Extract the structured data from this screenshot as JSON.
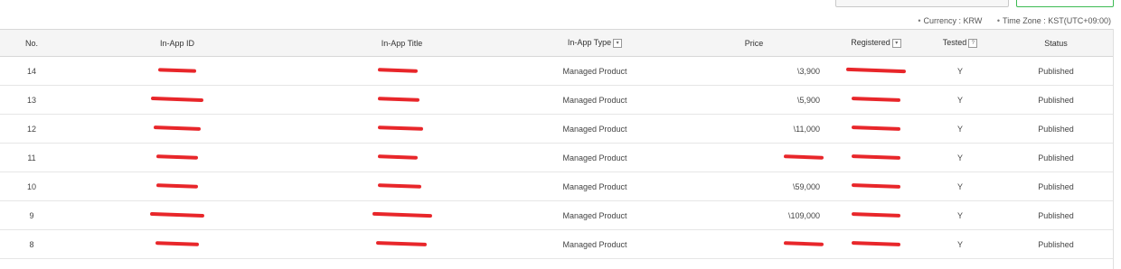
{
  "meta": {
    "currency": "Currency : KRW",
    "timezone": "Time Zone : KST(UTC+09:00)"
  },
  "columns": {
    "no": "No.",
    "inapp_id": "In-App ID",
    "inapp_title": "In-App Title",
    "inapp_type": "In-App Type",
    "price": "Price",
    "registered": "Registered",
    "tested": "Tested",
    "status": "Status"
  },
  "icons": {
    "sort": "chevron-down-icon",
    "help": "question-icon"
  },
  "rows": [
    {
      "no": "14",
      "id": "",
      "title": "",
      "type": "Managed Product",
      "price": "\\3,900",
      "registered": "",
      "tested": "Y",
      "status": "Published"
    },
    {
      "no": "13",
      "id": "",
      "title": "",
      "type": "Managed Product",
      "price": "\\5,900",
      "registered": "",
      "tested": "Y",
      "status": "Published"
    },
    {
      "no": "12",
      "id": "",
      "title": "",
      "type": "Managed Product",
      "price": "\\11,000",
      "registered": "",
      "tested": "Y",
      "status": "Published"
    },
    {
      "no": "11",
      "id": "",
      "title": "",
      "type": "Managed Product",
      "price": "",
      "registered": "",
      "tested": "Y",
      "status": "Published"
    },
    {
      "no": "10",
      "id": "",
      "title": "",
      "type": "Managed Product",
      "price": "\\59,000",
      "registered": "",
      "tested": "Y",
      "status": "Published"
    },
    {
      "no": "9",
      "id": "",
      "title": "",
      "type": "Managed Product",
      "price": "\\109,000",
      "registered": "",
      "tested": "Y",
      "status": "Published"
    },
    {
      "no": "8",
      "id": "",
      "title": "",
      "type": "Managed Product",
      "price": "",
      "registered": "",
      "tested": "Y",
      "status": "Published"
    }
  ]
}
